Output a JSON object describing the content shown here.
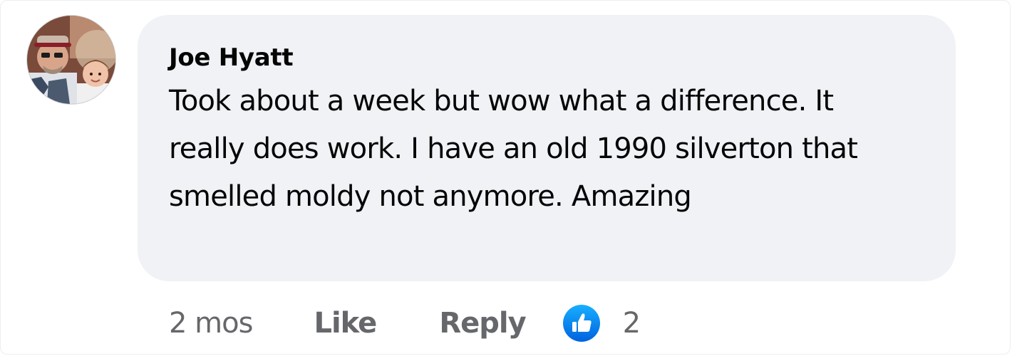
{
  "comment": {
    "author": "Joe Hyatt",
    "text": "Took about a week but wow what a difference. It really does work. I have an old 1990 silverton that smelled moldy not anymore. Amazing",
    "avatar_icon": "user-avatar-photo"
  },
  "actions": {
    "timestamp": "2 mos",
    "like_label": "Like",
    "reply_label": "Reply",
    "reaction_icon": "thumbs-up-icon",
    "reaction_count": "2"
  },
  "colors": {
    "bubble_bg": "#f0f2f5",
    "text": "#050505",
    "secondary_text": "#65676b",
    "like_blue": "#1877f2"
  }
}
